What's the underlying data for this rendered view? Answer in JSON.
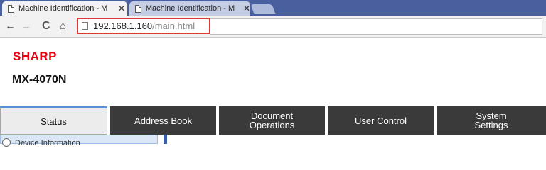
{
  "browser": {
    "tabs": [
      {
        "title": "Machine Identification - M",
        "active": true
      },
      {
        "title": "Machine Identification - M",
        "active": false
      }
    ],
    "url_host": "192.168.1.160",
    "url_path": "/main.html"
  },
  "header": {
    "brand": "SHARP",
    "model": "MX-4070N"
  },
  "nav": {
    "tabs": [
      {
        "label": "Status"
      },
      {
        "label": "Address Book"
      },
      {
        "label": "Document\nOperations"
      },
      {
        "label": "User Control"
      },
      {
        "label": "System\nSettings"
      }
    ]
  },
  "sidebar": {
    "item_label": "Device Information"
  }
}
